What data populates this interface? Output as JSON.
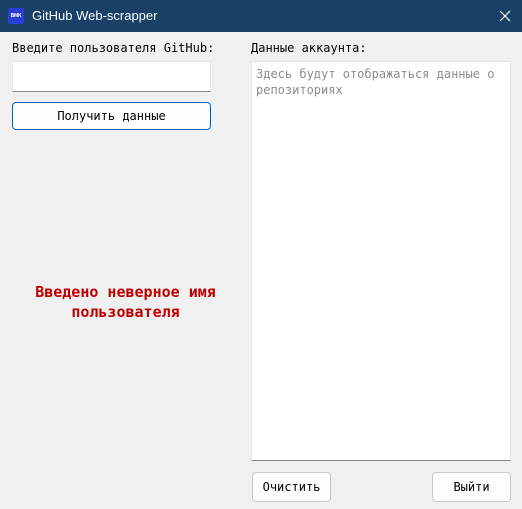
{
  "window": {
    "title": "GitHub Web-scrapper",
    "icon_text": "BMK",
    "icon_color": "#2a3fd6",
    "titlebar_color": "#1a4068"
  },
  "left_panel": {
    "user_label": "Введите пользователя GitHub:",
    "user_input_value": "",
    "get_button_label": "Получить данные",
    "error_message": "Введено неверное имя\nпользователя",
    "error_color": "#c00000"
  },
  "right_panel": {
    "account_label": "Данные аккаунта:",
    "account_placeholder": "Здесь будут отображаться данные о репозиториях"
  },
  "buttons": {
    "clear_label": "Очистить",
    "exit_label": "Выйти"
  }
}
